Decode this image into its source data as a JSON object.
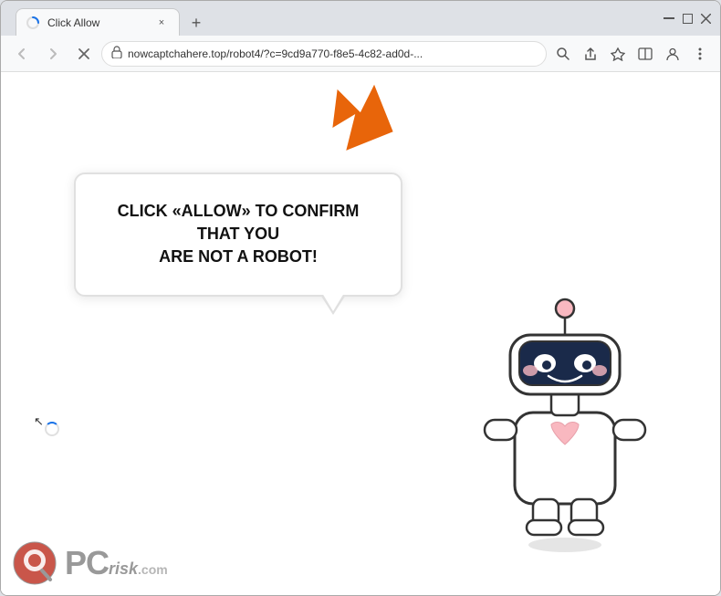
{
  "browser": {
    "tab": {
      "favicon": "loading",
      "title": "Click Allow",
      "close_label": "×"
    },
    "new_tab_label": "+",
    "window_controls": {
      "minimize": "─",
      "maximize": "□",
      "close": "×"
    },
    "toolbar": {
      "back_label": "←",
      "forward_label": "→",
      "reload_label": "×",
      "address": "nowcaptchahere.top/robot4/?c=9cd9a770-f8e5-4c82-ad0d-...",
      "search_label": "🔍",
      "share_label": "⬆",
      "bookmark_label": "☆",
      "split_label": "⊡",
      "profile_label": "👤",
      "menu_label": "⋮"
    }
  },
  "content": {
    "bubble_text_line1": "CLICK «ALLOW» TO CONFIRM THAT YOU",
    "bubble_text_line2": "ARE NOT A ROBOT!"
  },
  "pcrisk": {
    "pc_text": "PC",
    "risk_text": "risk",
    "com_text": ".com"
  }
}
